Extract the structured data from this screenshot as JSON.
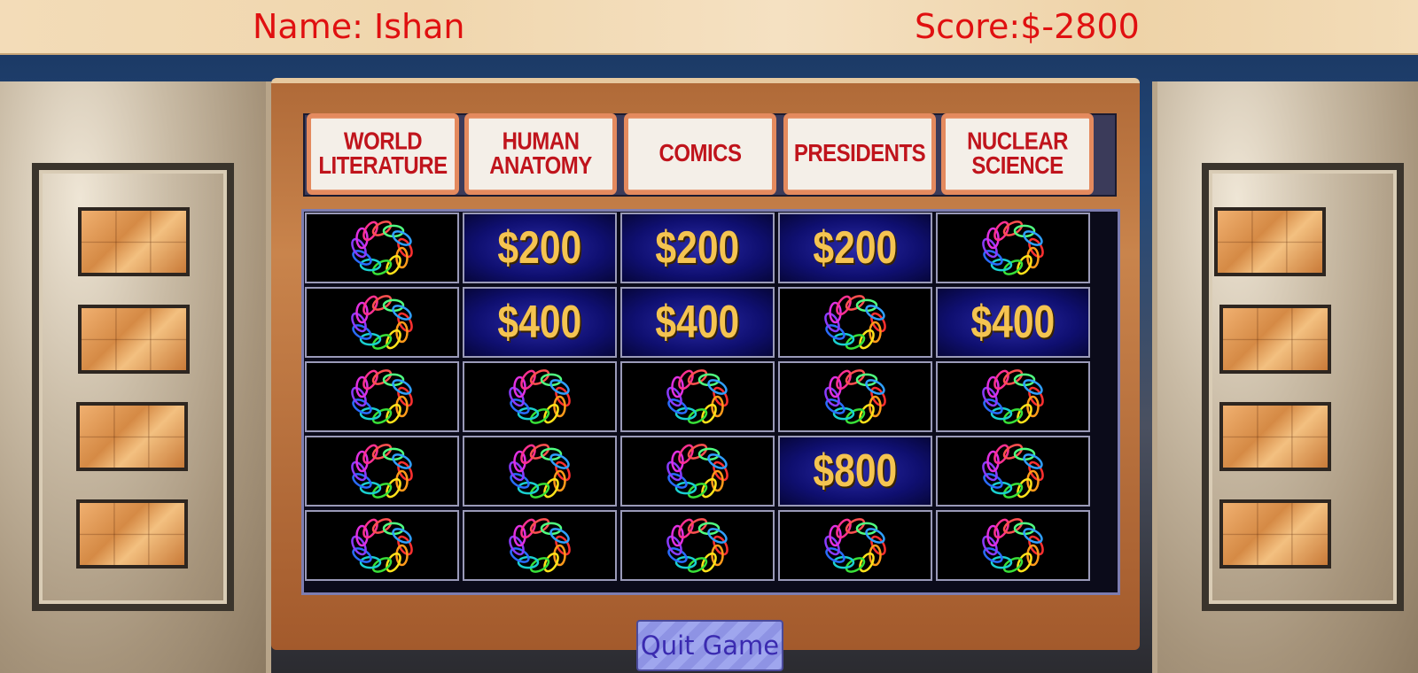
{
  "player": {
    "name_text": "Name: Ishan",
    "score_text": "Score:$-2800"
  },
  "categories": [
    "WORLD LITERATURE",
    "HUMAN ANATOMY",
    "COMICS",
    "PRESIDENTS",
    "NUCLEAR SCIENCE"
  ],
  "category_lines": [
    [
      "WORLD",
      "LITERATURE"
    ],
    [
      "HUMAN",
      "ANATOMY"
    ],
    [
      "COMICS"
    ],
    [
      "PRESIDENTS"
    ],
    [
      "NUCLEAR",
      "SCIENCE"
    ]
  ],
  "board": [
    [
      "",
      "$200",
      "$200",
      "$200",
      ""
    ],
    [
      "",
      "$400",
      "$400",
      "",
      "$400"
    ],
    [
      "",
      "",
      "",
      "",
      ""
    ],
    [
      "",
      "",
      "",
      "$800",
      ""
    ],
    [
      "",
      "",
      "",
      "",
      ""
    ]
  ],
  "quit_label": "Quit Game",
  "colors": {
    "name_score": "#e01010",
    "amount": "#f5c451",
    "category_text": "#c0141c"
  }
}
